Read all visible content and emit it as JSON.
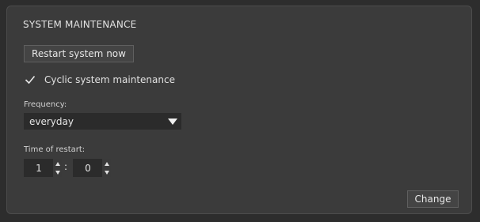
{
  "section": {
    "title": "SYSTEM MAINTENANCE"
  },
  "buttons": {
    "restart_label": "Restart system now",
    "change_label": "Change"
  },
  "cyclic": {
    "label": "Cyclic system maintenance",
    "checked": true
  },
  "frequency": {
    "label": "Frequency:",
    "selected": "everyday"
  },
  "time_of_restart": {
    "label": "Time of restart:",
    "hours": "1",
    "separator": ":",
    "minutes": "0"
  },
  "icons": {
    "checkbox": "checkmark-icon",
    "dropdown": "triangle-down-icon",
    "spin_up": "arrow-up-icon",
    "spin_down": "arrow-down-icon"
  },
  "colors": {
    "background": "#2d2d2d",
    "panel": "#3b3b3b",
    "field": "#2b2b2b",
    "text": "#e2e2e2"
  }
}
